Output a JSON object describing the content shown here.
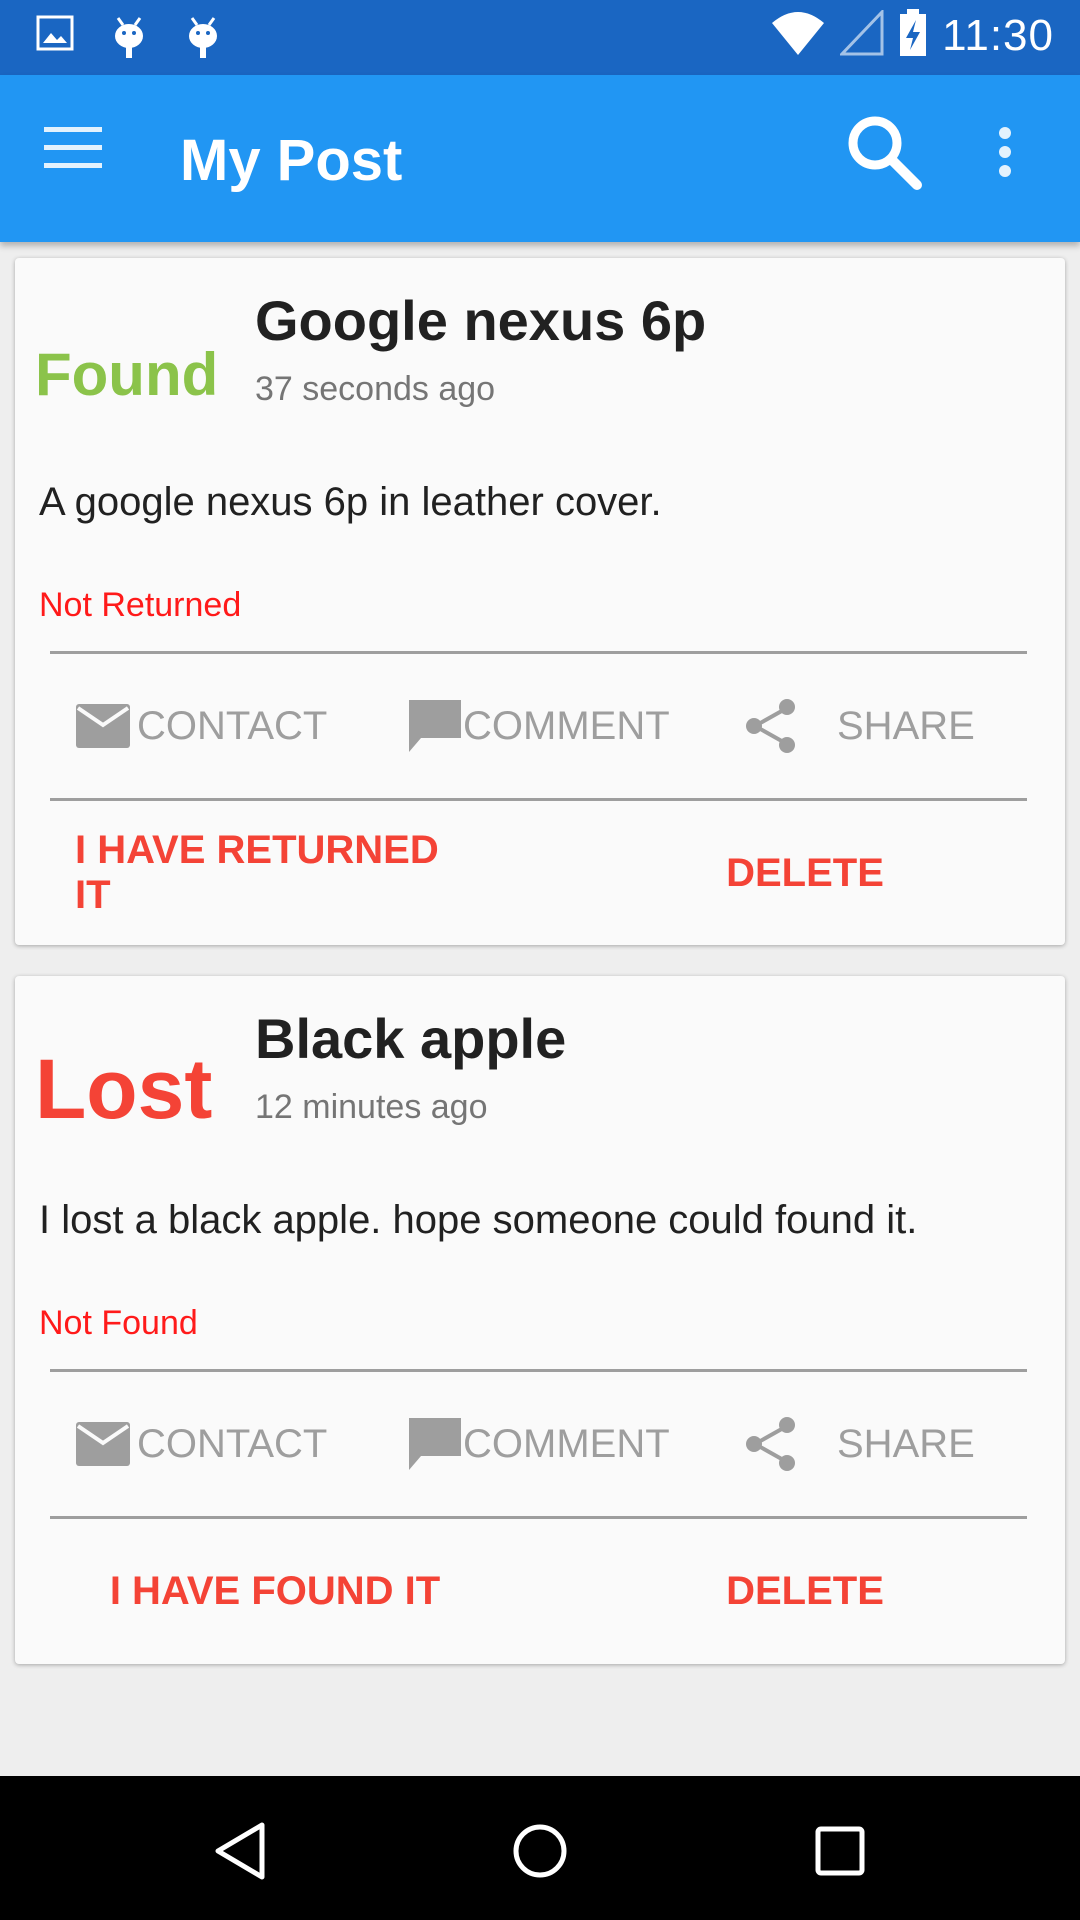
{
  "status_bar": {
    "time": "11:30",
    "left_icons": [
      "image-notification-icon",
      "android-notification-icon",
      "android-notification-icon"
    ],
    "right_icons": [
      "wifi-icon",
      "cell-signal-icon",
      "battery-charging-icon"
    ]
  },
  "app_bar": {
    "title": "My Post",
    "color": "#2196f3"
  },
  "posts": [
    {
      "badge": "Found",
      "badge_color": "#8bc34a",
      "title": "Google nexus 6p",
      "time": "37 seconds ago",
      "description": "A google nexus 6p in leather cover.",
      "status": "Not Returned",
      "actions": {
        "contact": "CONTACT",
        "comment": "COMMENT",
        "share": "SHARE"
      },
      "primary_button": "I HAVE RETURNED IT",
      "delete_button": "DELETE"
    },
    {
      "badge": "Lost",
      "badge_color": "#f44336",
      "title": "Black apple",
      "time": "12 minutes ago",
      "description": "I lost a black apple. hope someone could found it.",
      "status": "Not Found",
      "actions": {
        "contact": "CONTACT",
        "comment": "COMMENT",
        "share": "SHARE"
      },
      "primary_button": "I HAVE FOUND IT",
      "delete_button": "DELETE"
    }
  ],
  "colors": {
    "status_bar": "#1a66c2",
    "accent_red": "#f44336",
    "status_red": "#ff1a1a"
  }
}
